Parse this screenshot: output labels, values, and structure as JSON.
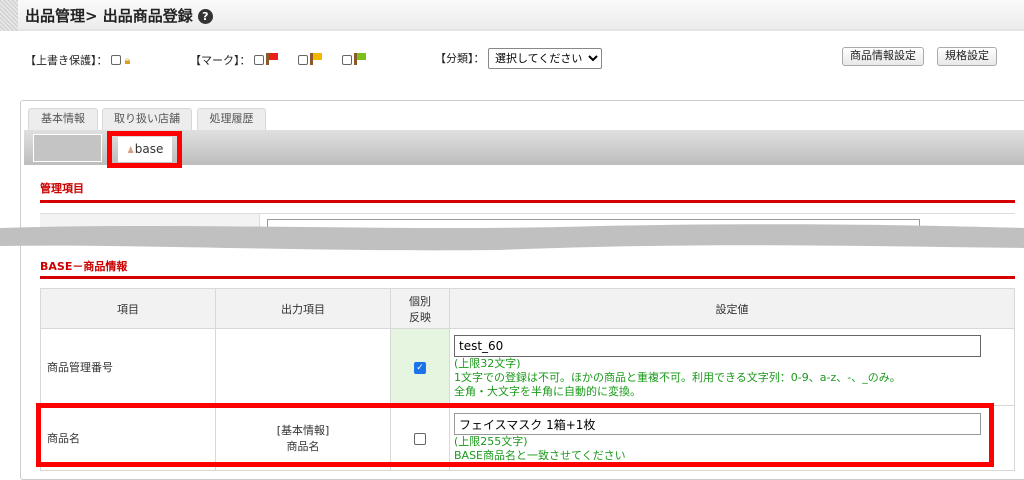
{
  "header": {
    "title": "出品管理> 出品商品登録",
    "help_icon": "question-circle-icon"
  },
  "toolbar": {
    "overwrite_label": "【上書き保護】：",
    "mark_label": "【マーク】：",
    "category_label": "【分類】：",
    "category_selected": "選択してください",
    "flags": [
      {
        "color": "#e8201a"
      },
      {
        "color": "#f2b800"
      },
      {
        "color": "#7cbf1a"
      }
    ],
    "product_settings_button": "商品情報設定",
    "spec_settings_button": "規格設定"
  },
  "tabs": [
    {
      "label": "基本情報"
    },
    {
      "label": "取り扱い店舗"
    },
    {
      "label": "処理履歴"
    }
  ],
  "subtab": {
    "label": "base"
  },
  "sections": {
    "management": "管理項目",
    "base_info": "BASE－商品情報"
  },
  "table": {
    "headers": [
      "項目",
      "出力項目",
      "個別\n反映",
      "設定値"
    ],
    "header_individual_1": "個別",
    "header_individual_2": "反映",
    "rows": [
      {
        "item": "商品管理番号",
        "output": "",
        "individual": true,
        "value": "test_60",
        "notes": [
          "(上限32文字)",
          "1文字での登録は不可。ほかの商品と重複不可。利用できる文字列：0-9、a-z、-、_のみ。",
          "全角・大文字を半角に自動的に変換。"
        ]
      },
      {
        "item": "商品名",
        "output_1": "[基本情報]",
        "output_2": "商品名",
        "individual": false,
        "value": "フェイスマスク 1箱+1枚",
        "notes": [
          "(上限255文字)",
          "BASE商品名と一致させてください"
        ]
      }
    ]
  },
  "colors": {
    "accent_red": "#d40000",
    "highlight_red": "#ff0000",
    "note_green": "#1a9a1a"
  }
}
